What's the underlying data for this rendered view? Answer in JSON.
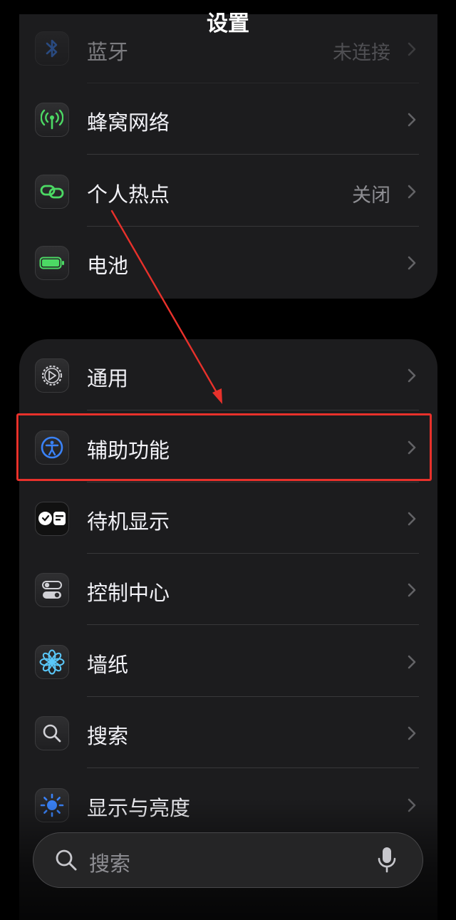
{
  "header": {
    "title": "设置"
  },
  "group1": [
    {
      "name": "bluetooth",
      "label": "蓝牙",
      "value": "未连接",
      "icon": "bluetooth-icon"
    },
    {
      "name": "cellular",
      "label": "蜂窝网络",
      "value": "",
      "icon": "antenna-icon"
    },
    {
      "name": "hotspot",
      "label": "个人热点",
      "value": "关闭",
      "icon": "link-icon"
    },
    {
      "name": "battery",
      "label": "电池",
      "value": "",
      "icon": "battery-icon"
    }
  ],
  "group2": [
    {
      "name": "general",
      "label": "通用",
      "icon": "gear-icon"
    },
    {
      "name": "accessibility",
      "label": "辅助功能",
      "icon": "accessibility-icon"
    },
    {
      "name": "standby",
      "label": "待机显示",
      "icon": "standby-icon"
    },
    {
      "name": "control-center",
      "label": "控制中心",
      "icon": "toggles-icon"
    },
    {
      "name": "wallpaper",
      "label": "墙纸",
      "icon": "flower-icon"
    },
    {
      "name": "search",
      "label": "搜索",
      "icon": "search-icon"
    },
    {
      "name": "display",
      "label": "显示与亮度",
      "icon": "sun-icon"
    }
  ],
  "search": {
    "placeholder": "搜索"
  },
  "colors": {
    "accent_blue": "#3a82f7",
    "green": "#4cd964",
    "annotation_red": "#e8312b"
  }
}
